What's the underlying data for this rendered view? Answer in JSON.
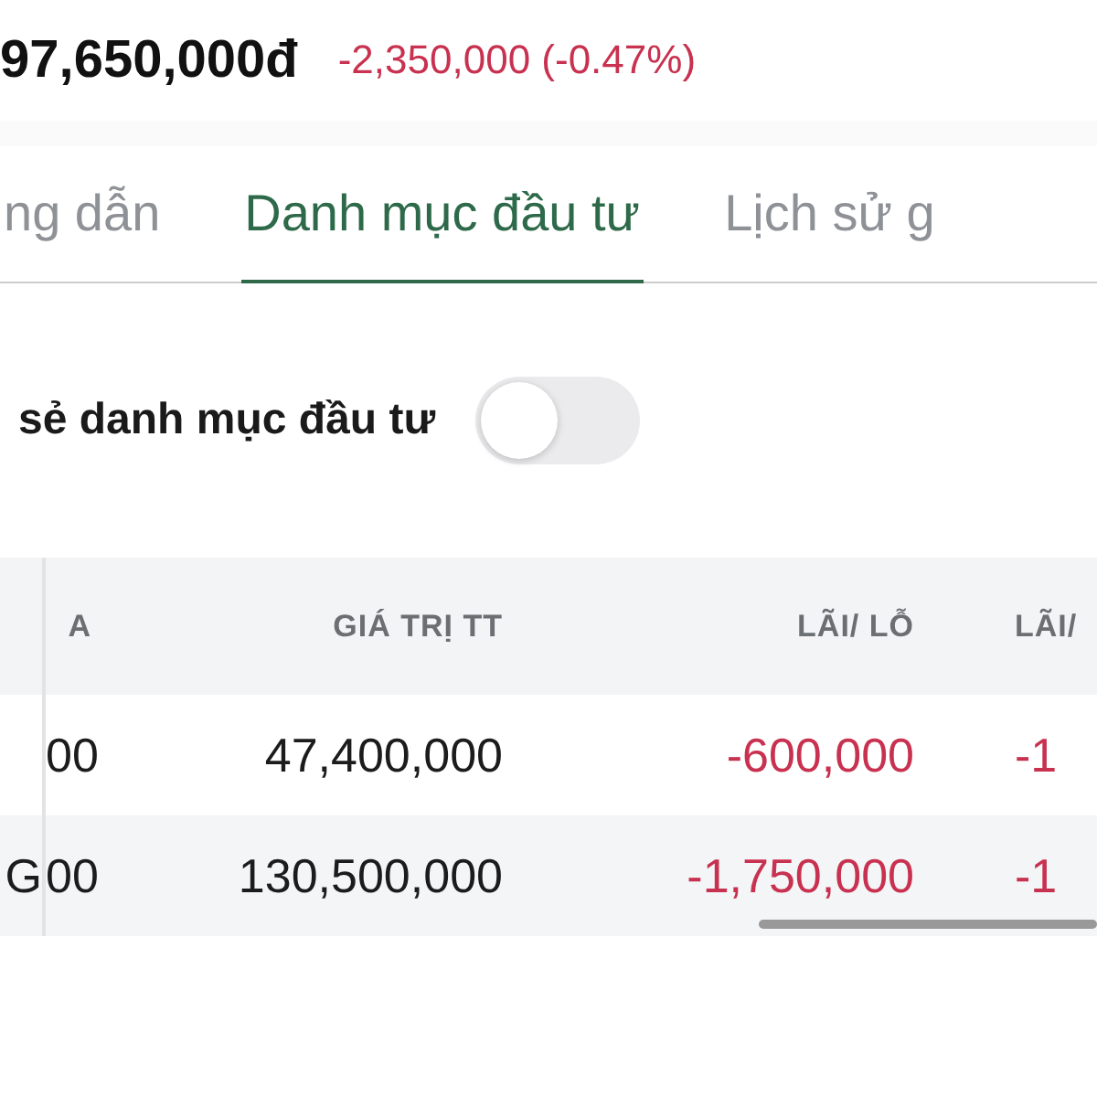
{
  "balance": {
    "amount": "97,650,000đ",
    "change": "-2,350,000 (-0.47%)",
    "negative": true
  },
  "tabs": [
    {
      "label": "ng dẫn",
      "selected": false
    },
    {
      "label": "Danh mục đầu tư",
      "selected": true
    },
    {
      "label": "Lịch sử g",
      "selected": false
    }
  ],
  "share_toggle": {
    "label": "sẻ danh mục đầu tư",
    "on": false
  },
  "table": {
    "columns": [
      "A",
      "GIÁ TRỊ TT",
      "LÃI/ LỖ",
      "LÃI/"
    ],
    "rows": [
      {
        "cells": [
          "00",
          "47,400,000",
          "-600,000",
          "-1"
        ],
        "negative": true
      },
      {
        "ticker": "G",
        "cells": [
          "00",
          "130,500,000",
          "-1,750,000",
          "-1"
        ],
        "negative": true
      }
    ]
  }
}
